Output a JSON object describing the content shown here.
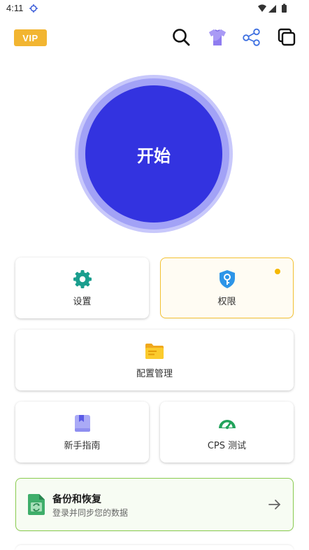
{
  "status_bar": {
    "time": "4:11"
  },
  "header": {
    "vip_label": "VIP",
    "icons": [
      "search-icon",
      "tshirt-icon",
      "share-icon",
      "copy-icon"
    ]
  },
  "start": {
    "label": "开始",
    "color": "#3333e0"
  },
  "tiles": {
    "settings": {
      "label": "设置",
      "icon": "gear-icon"
    },
    "permissions": {
      "label": "权限",
      "icon": "shield-key-icon"
    },
    "config": {
      "label": "配置管理",
      "icon": "folder-icon"
    },
    "guide": {
      "label": "新手指南",
      "icon": "bookmark-icon"
    },
    "cps": {
      "label": "CPS 测试",
      "icon": "speedometer-icon"
    }
  },
  "backup": {
    "title": "备份和恢复",
    "subtitle": "登录并同步您的数据",
    "icon": "backup-file-icon"
  },
  "colors": {
    "vip": "#f2b531",
    "highlight_border": "#f4c233",
    "backup_border": "#8acc4f"
  }
}
